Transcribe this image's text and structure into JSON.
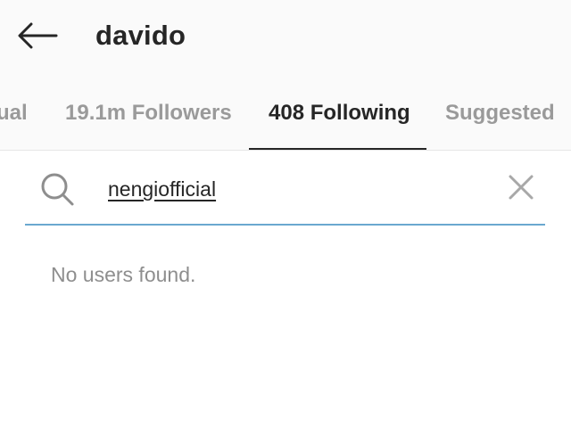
{
  "header": {
    "back_icon": "arrow-left-icon",
    "title": "davido"
  },
  "tabs": [
    {
      "label": "ual",
      "active": false
    },
    {
      "label": "19.1m Followers",
      "active": false
    },
    {
      "label": "408 Following",
      "active": true
    },
    {
      "label": "Suggested",
      "active": false
    }
  ],
  "search": {
    "icon": "search-icon",
    "value": "nengiofficial",
    "clear_icon": "close-icon",
    "underline_color": "#6aa8cf"
  },
  "results": {
    "empty_message": "No users found."
  }
}
